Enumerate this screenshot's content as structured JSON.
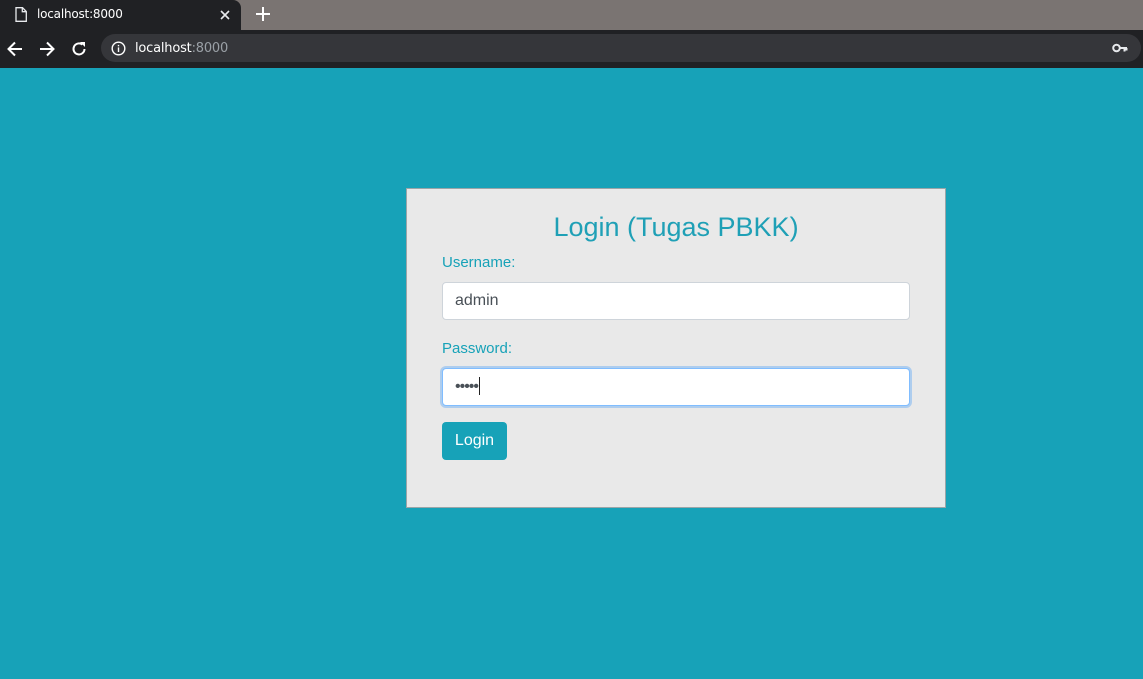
{
  "browser": {
    "tab_title": "localhost:8000",
    "url_host": "localhost",
    "url_port": ":8000"
  },
  "form": {
    "title": "Login (Tugas PBKK)",
    "username_label": "Username:",
    "username_value": "admin",
    "password_label": "Password:",
    "password_mask": "•••••",
    "submit_label": "Login"
  },
  "colors": {
    "page_background": "#17a2b8",
    "card_background": "#e9e9e9",
    "accent": "#17a2b8"
  }
}
